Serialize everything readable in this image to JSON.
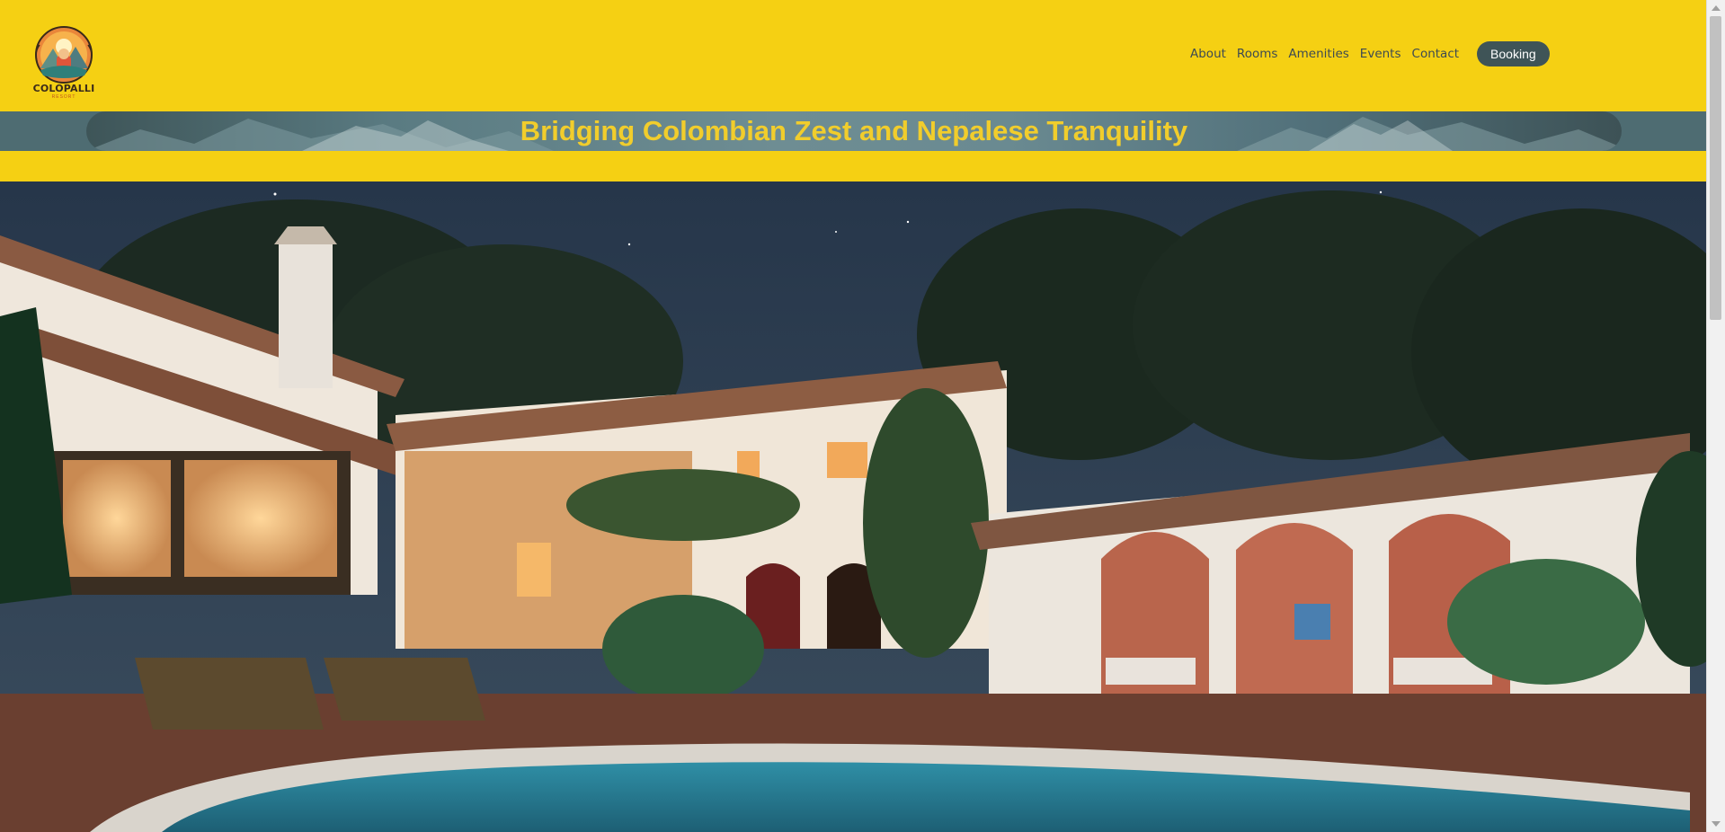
{
  "brand": {
    "name": "COLOPALLI",
    "tagline": "RESORT"
  },
  "nav": {
    "items": [
      "About",
      "Rooms",
      "Amenities",
      "Events",
      "Contact"
    ],
    "booking_label": "Booking"
  },
  "banner": {
    "title": "Bridging Colombian Zest and Nepalese Tranquility"
  },
  "colors": {
    "primary": "#f5d013",
    "accent": "#3f5457",
    "banner_text": "#f1cd2c"
  },
  "icons": {
    "logo": "sun-mountain-logo-icon"
  }
}
